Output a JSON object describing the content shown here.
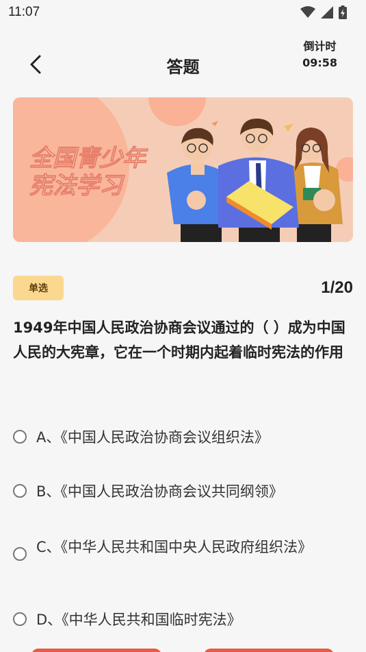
{
  "status_bar": {
    "time": "11:07",
    "icons": [
      "wifi-icon",
      "signal-icon",
      "battery-icon"
    ]
  },
  "header": {
    "title": "答题",
    "back_icon": "chevron-left-icon",
    "timer_label": "倒计时",
    "timer_value": "09:58"
  },
  "banner": {
    "text_line1": "全国青少年",
    "text_line2": "宪法学习"
  },
  "question": {
    "type": "单选",
    "progress": "1/20",
    "text": "1949年中国人民政治协商会议通过的（  ）成为中国人民的大宪章，它在一个时期内起着临时宪法的作用",
    "options": [
      {
        "label": "A、《中国人民政治协商会议组织法》"
      },
      {
        "label": "B、《中国人民政治协商会议共同纲领》"
      },
      {
        "label": "C、《中华人民共和国中央人民政府组织法》"
      },
      {
        "label": "D、《中华人民共和国临时宪法》"
      }
    ]
  },
  "colors": {
    "accent": "#e85a45",
    "badge_bg": "#fbd890",
    "banner_bg": "#f5cdb6"
  }
}
